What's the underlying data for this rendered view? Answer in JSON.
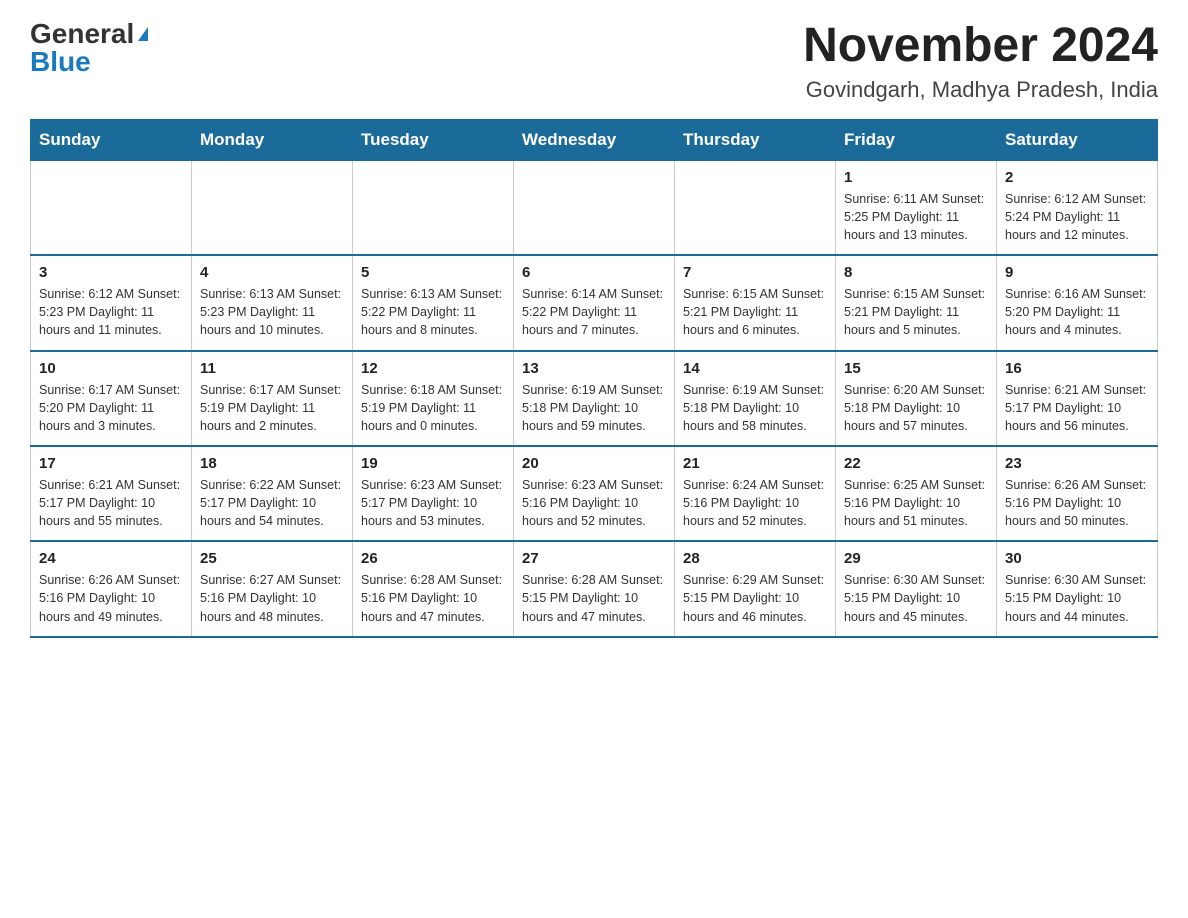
{
  "header": {
    "logo_general": "General",
    "logo_blue": "Blue",
    "month_year": "November 2024",
    "location": "Govindgarh, Madhya Pradesh, India"
  },
  "days_of_week": [
    "Sunday",
    "Monday",
    "Tuesday",
    "Wednesday",
    "Thursday",
    "Friday",
    "Saturday"
  ],
  "weeks": [
    [
      {
        "day": "",
        "info": ""
      },
      {
        "day": "",
        "info": ""
      },
      {
        "day": "",
        "info": ""
      },
      {
        "day": "",
        "info": ""
      },
      {
        "day": "",
        "info": ""
      },
      {
        "day": "1",
        "info": "Sunrise: 6:11 AM\nSunset: 5:25 PM\nDaylight: 11 hours and 13 minutes."
      },
      {
        "day": "2",
        "info": "Sunrise: 6:12 AM\nSunset: 5:24 PM\nDaylight: 11 hours and 12 minutes."
      }
    ],
    [
      {
        "day": "3",
        "info": "Sunrise: 6:12 AM\nSunset: 5:23 PM\nDaylight: 11 hours and 11 minutes."
      },
      {
        "day": "4",
        "info": "Sunrise: 6:13 AM\nSunset: 5:23 PM\nDaylight: 11 hours and 10 minutes."
      },
      {
        "day": "5",
        "info": "Sunrise: 6:13 AM\nSunset: 5:22 PM\nDaylight: 11 hours and 8 minutes."
      },
      {
        "day": "6",
        "info": "Sunrise: 6:14 AM\nSunset: 5:22 PM\nDaylight: 11 hours and 7 minutes."
      },
      {
        "day": "7",
        "info": "Sunrise: 6:15 AM\nSunset: 5:21 PM\nDaylight: 11 hours and 6 minutes."
      },
      {
        "day": "8",
        "info": "Sunrise: 6:15 AM\nSunset: 5:21 PM\nDaylight: 11 hours and 5 minutes."
      },
      {
        "day": "9",
        "info": "Sunrise: 6:16 AM\nSunset: 5:20 PM\nDaylight: 11 hours and 4 minutes."
      }
    ],
    [
      {
        "day": "10",
        "info": "Sunrise: 6:17 AM\nSunset: 5:20 PM\nDaylight: 11 hours and 3 minutes."
      },
      {
        "day": "11",
        "info": "Sunrise: 6:17 AM\nSunset: 5:19 PM\nDaylight: 11 hours and 2 minutes."
      },
      {
        "day": "12",
        "info": "Sunrise: 6:18 AM\nSunset: 5:19 PM\nDaylight: 11 hours and 0 minutes."
      },
      {
        "day": "13",
        "info": "Sunrise: 6:19 AM\nSunset: 5:18 PM\nDaylight: 10 hours and 59 minutes."
      },
      {
        "day": "14",
        "info": "Sunrise: 6:19 AM\nSunset: 5:18 PM\nDaylight: 10 hours and 58 minutes."
      },
      {
        "day": "15",
        "info": "Sunrise: 6:20 AM\nSunset: 5:18 PM\nDaylight: 10 hours and 57 minutes."
      },
      {
        "day": "16",
        "info": "Sunrise: 6:21 AM\nSunset: 5:17 PM\nDaylight: 10 hours and 56 minutes."
      }
    ],
    [
      {
        "day": "17",
        "info": "Sunrise: 6:21 AM\nSunset: 5:17 PM\nDaylight: 10 hours and 55 minutes."
      },
      {
        "day": "18",
        "info": "Sunrise: 6:22 AM\nSunset: 5:17 PM\nDaylight: 10 hours and 54 minutes."
      },
      {
        "day": "19",
        "info": "Sunrise: 6:23 AM\nSunset: 5:17 PM\nDaylight: 10 hours and 53 minutes."
      },
      {
        "day": "20",
        "info": "Sunrise: 6:23 AM\nSunset: 5:16 PM\nDaylight: 10 hours and 52 minutes."
      },
      {
        "day": "21",
        "info": "Sunrise: 6:24 AM\nSunset: 5:16 PM\nDaylight: 10 hours and 52 minutes."
      },
      {
        "day": "22",
        "info": "Sunrise: 6:25 AM\nSunset: 5:16 PM\nDaylight: 10 hours and 51 minutes."
      },
      {
        "day": "23",
        "info": "Sunrise: 6:26 AM\nSunset: 5:16 PM\nDaylight: 10 hours and 50 minutes."
      }
    ],
    [
      {
        "day": "24",
        "info": "Sunrise: 6:26 AM\nSunset: 5:16 PM\nDaylight: 10 hours and 49 minutes."
      },
      {
        "day": "25",
        "info": "Sunrise: 6:27 AM\nSunset: 5:16 PM\nDaylight: 10 hours and 48 minutes."
      },
      {
        "day": "26",
        "info": "Sunrise: 6:28 AM\nSunset: 5:16 PM\nDaylight: 10 hours and 47 minutes."
      },
      {
        "day": "27",
        "info": "Sunrise: 6:28 AM\nSunset: 5:15 PM\nDaylight: 10 hours and 47 minutes."
      },
      {
        "day": "28",
        "info": "Sunrise: 6:29 AM\nSunset: 5:15 PM\nDaylight: 10 hours and 46 minutes."
      },
      {
        "day": "29",
        "info": "Sunrise: 6:30 AM\nSunset: 5:15 PM\nDaylight: 10 hours and 45 minutes."
      },
      {
        "day": "30",
        "info": "Sunrise: 6:30 AM\nSunset: 5:15 PM\nDaylight: 10 hours and 44 minutes."
      }
    ]
  ]
}
